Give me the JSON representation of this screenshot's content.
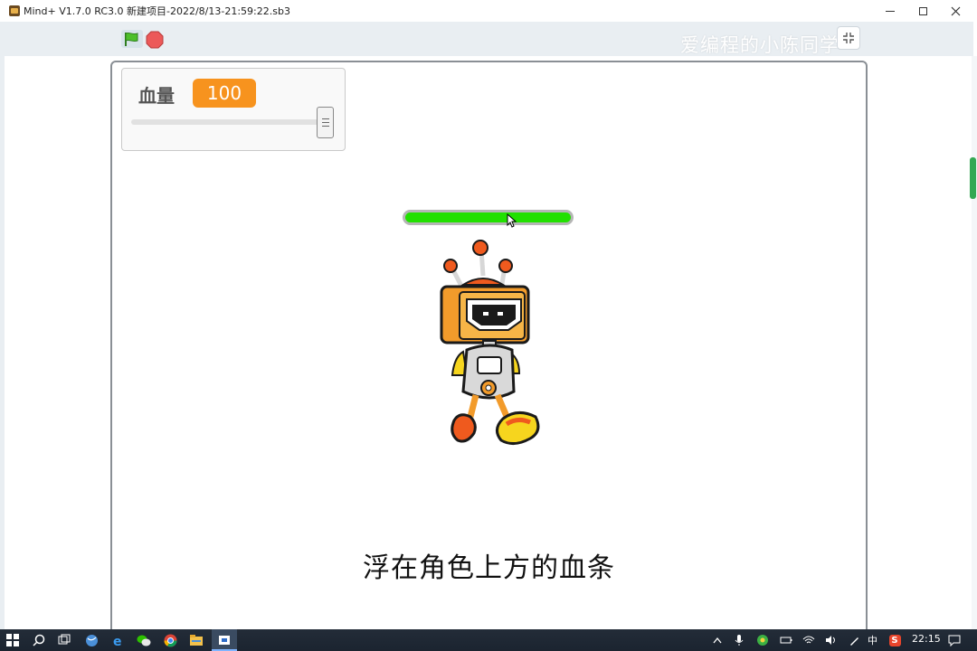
{
  "window": {
    "title": "Mind+ V1.7.0 RC3.0   新建项目-2022/8/13-21:59:22.sb3",
    "app_icon": "mindplus-app-icon"
  },
  "toolbar": {
    "green_flag_icon": "green-flag-icon",
    "stop_icon": "stop-sign-icon",
    "watermark": "爱编程的小陈同学",
    "shrink_stage_icon": "shrink-stage-icon"
  },
  "stage": {
    "variable_monitor": {
      "label": "血量",
      "value": "100",
      "slider_fraction": 1.0
    },
    "health_bar": {
      "fill_fraction": 1.0,
      "color": "#22e000"
    },
    "sprite": "robot-sprite",
    "caption": "浮在角色上方的血条"
  },
  "taskbar": {
    "icons": [
      "windows-start-icon",
      "search-icon",
      "task-view-icon",
      "browser-icon",
      "edge-icon",
      "wechat-icon",
      "chrome-icon",
      "file-explorer-icon",
      "mindplus-taskbar-icon"
    ],
    "tray_ime": "中",
    "tray_ime_s": "S",
    "clock": "22:15"
  },
  "colors": {
    "accent_orange": "#f7931e",
    "stage_border": "#8a8f95",
    "toolbar_bg": "#e9eef2",
    "health_green": "#22e000"
  }
}
